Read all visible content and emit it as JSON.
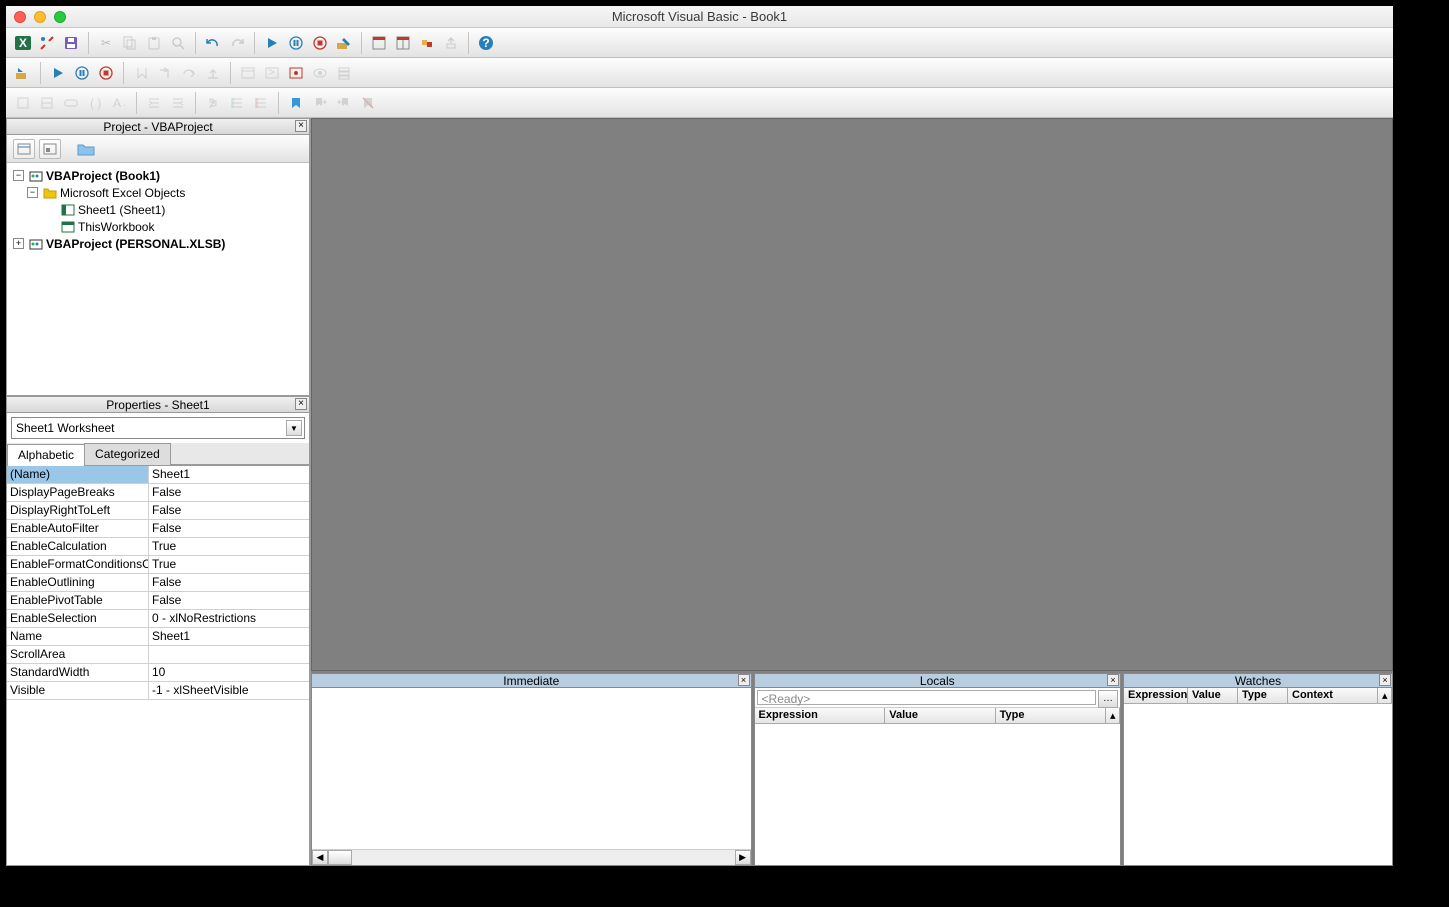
{
  "window": {
    "title": "Microsoft Visual Basic - Book1"
  },
  "project_panel": {
    "title": "Project - VBAProject",
    "tree": {
      "root1": "VBAProject (Book1)",
      "folder1": "Microsoft Excel Objects",
      "item1": "Sheet1 (Sheet1)",
      "item2": "ThisWorkbook",
      "root2": "VBAProject (PERSONAL.XLSB)"
    }
  },
  "properties_panel": {
    "title": "Properties - Sheet1",
    "combo": "Sheet1 Worksheet",
    "tabs": {
      "alpha": "Alphabetic",
      "cat": "Categorized"
    },
    "rows": [
      {
        "name": "(Name)",
        "value": "Sheet1"
      },
      {
        "name": "DisplayPageBreaks",
        "value": "False"
      },
      {
        "name": "DisplayRightToLeft",
        "value": "False"
      },
      {
        "name": "EnableAutoFilter",
        "value": "False"
      },
      {
        "name": "EnableCalculation",
        "value": "True"
      },
      {
        "name": "EnableFormatConditionsCalculation",
        "value": "True"
      },
      {
        "name": "EnableOutlining",
        "value": "False"
      },
      {
        "name": "EnablePivotTable",
        "value": "False"
      },
      {
        "name": "EnableSelection",
        "value": "0 - xlNoRestrictions"
      },
      {
        "name": "Name",
        "value": "Sheet1"
      },
      {
        "name": "ScrollArea",
        "value": ""
      },
      {
        "name": "StandardWidth",
        "value": "10"
      },
      {
        "name": "Visible",
        "value": "-1 - xlSheetVisible"
      }
    ]
  },
  "immediate": {
    "title": "Immediate"
  },
  "locals": {
    "title": "Locals",
    "ready": "<Ready>",
    "cols": {
      "expr": "Expression",
      "val": "Value",
      "type": "Type"
    }
  },
  "watches": {
    "title": "Watches",
    "cols": {
      "expr": "Expression",
      "val": "Value",
      "type": "Type",
      "ctx": "Context"
    }
  }
}
